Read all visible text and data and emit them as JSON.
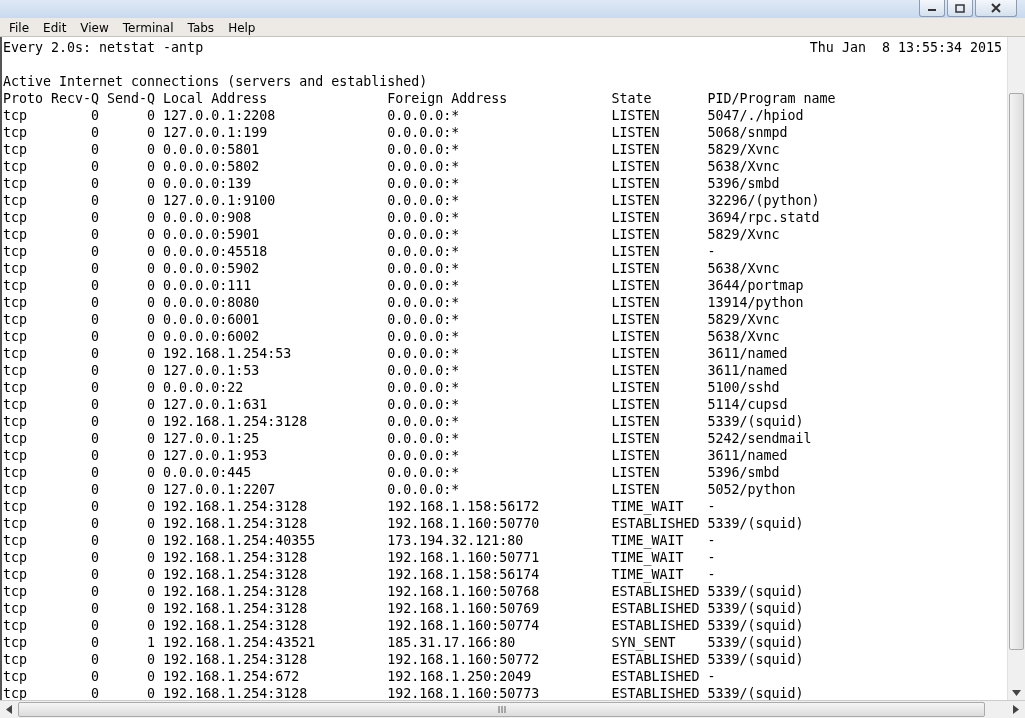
{
  "menu": [
    "File",
    "Edit",
    "View",
    "Terminal",
    "Tabs",
    "Help"
  ],
  "terminal": {
    "command": "Every 2.0s: netstat -antp",
    "clock": "Thu Jan  8 13:55:34 2015",
    "title": "Active Internet connections (servers and established)",
    "columns": [
      "Proto",
      "Recv-Q",
      "Send-Q",
      "Local Address",
      "Foreign Address",
      "State",
      "PID/Program name"
    ],
    "rows": [
      [
        "tcp",
        "0",
        "0",
        "127.0.0.1:2208",
        "0.0.0.0:*",
        "LISTEN",
        "5047/./hpiod"
      ],
      [
        "tcp",
        "0",
        "0",
        "127.0.0.1:199",
        "0.0.0.0:*",
        "LISTEN",
        "5068/snmpd"
      ],
      [
        "tcp",
        "0",
        "0",
        "0.0.0.0:5801",
        "0.0.0.0:*",
        "LISTEN",
        "5829/Xvnc"
      ],
      [
        "tcp",
        "0",
        "0",
        "0.0.0.0:5802",
        "0.0.0.0:*",
        "LISTEN",
        "5638/Xvnc"
      ],
      [
        "tcp",
        "0",
        "0",
        "0.0.0.0:139",
        "0.0.0.0:*",
        "LISTEN",
        "5396/smbd"
      ],
      [
        "tcp",
        "0",
        "0",
        "127.0.0.1:9100",
        "0.0.0.0:*",
        "LISTEN",
        "32296/(python)"
      ],
      [
        "tcp",
        "0",
        "0",
        "0.0.0.0:908",
        "0.0.0.0:*",
        "LISTEN",
        "3694/rpc.statd"
      ],
      [
        "tcp",
        "0",
        "0",
        "0.0.0.0:5901",
        "0.0.0.0:*",
        "LISTEN",
        "5829/Xvnc"
      ],
      [
        "tcp",
        "0",
        "0",
        "0.0.0.0:45518",
        "0.0.0.0:*",
        "LISTEN",
        "-"
      ],
      [
        "tcp",
        "0",
        "0",
        "0.0.0.0:5902",
        "0.0.0.0:*",
        "LISTEN",
        "5638/Xvnc"
      ],
      [
        "tcp",
        "0",
        "0",
        "0.0.0.0:111",
        "0.0.0.0:*",
        "LISTEN",
        "3644/portmap"
      ],
      [
        "tcp",
        "0",
        "0",
        "0.0.0.0:8080",
        "0.0.0.0:*",
        "LISTEN",
        "13914/python"
      ],
      [
        "tcp",
        "0",
        "0",
        "0.0.0.0:6001",
        "0.0.0.0:*",
        "LISTEN",
        "5829/Xvnc"
      ],
      [
        "tcp",
        "0",
        "0",
        "0.0.0.0:6002",
        "0.0.0.0:*",
        "LISTEN",
        "5638/Xvnc"
      ],
      [
        "tcp",
        "0",
        "0",
        "192.168.1.254:53",
        "0.0.0.0:*",
        "LISTEN",
        "3611/named"
      ],
      [
        "tcp",
        "0",
        "0",
        "127.0.0.1:53",
        "0.0.0.0:*",
        "LISTEN",
        "3611/named"
      ],
      [
        "tcp",
        "0",
        "0",
        "0.0.0.0:22",
        "0.0.0.0:*",
        "LISTEN",
        "5100/sshd"
      ],
      [
        "tcp",
        "0",
        "0",
        "127.0.0.1:631",
        "0.0.0.0:*",
        "LISTEN",
        "5114/cupsd"
      ],
      [
        "tcp",
        "0",
        "0",
        "192.168.1.254:3128",
        "0.0.0.0:*",
        "LISTEN",
        "5339/(squid)"
      ],
      [
        "tcp",
        "0",
        "0",
        "127.0.0.1:25",
        "0.0.0.0:*",
        "LISTEN",
        "5242/sendmail"
      ],
      [
        "tcp",
        "0",
        "0",
        "127.0.0.1:953",
        "0.0.0.0:*",
        "LISTEN",
        "3611/named"
      ],
      [
        "tcp",
        "0",
        "0",
        "0.0.0.0:445",
        "0.0.0.0:*",
        "LISTEN",
        "5396/smbd"
      ],
      [
        "tcp",
        "0",
        "0",
        "127.0.0.1:2207",
        "0.0.0.0:*",
        "LISTEN",
        "5052/python"
      ],
      [
        "tcp",
        "0",
        "0",
        "192.168.1.254:3128",
        "192.168.1.158:56172",
        "TIME_WAIT",
        "-"
      ],
      [
        "tcp",
        "0",
        "0",
        "192.168.1.254:3128",
        "192.168.1.160:50770",
        "ESTABLISHED",
        "5339/(squid)"
      ],
      [
        "tcp",
        "0",
        "0",
        "192.168.1.254:40355",
        "173.194.32.121:80",
        "TIME_WAIT",
        "-"
      ],
      [
        "tcp",
        "0",
        "0",
        "192.168.1.254:3128",
        "192.168.1.160:50771",
        "TIME_WAIT",
        "-"
      ],
      [
        "tcp",
        "0",
        "0",
        "192.168.1.254:3128",
        "192.168.1.158:56174",
        "TIME_WAIT",
        "-"
      ],
      [
        "tcp",
        "0",
        "0",
        "192.168.1.254:3128",
        "192.168.1.160:50768",
        "ESTABLISHED",
        "5339/(squid)"
      ],
      [
        "tcp",
        "0",
        "0",
        "192.168.1.254:3128",
        "192.168.1.160:50769",
        "ESTABLISHED",
        "5339/(squid)"
      ],
      [
        "tcp",
        "0",
        "0",
        "192.168.1.254:3128",
        "192.168.1.160:50774",
        "ESTABLISHED",
        "5339/(squid)"
      ],
      [
        "tcp",
        "0",
        "1",
        "192.168.1.254:43521",
        "185.31.17.166:80",
        "SYN_SENT",
        "5339/(squid)"
      ],
      [
        "tcp",
        "0",
        "0",
        "192.168.1.254:3128",
        "192.168.1.160:50772",
        "ESTABLISHED",
        "5339/(squid)"
      ],
      [
        "tcp",
        "0",
        "0",
        "192.168.1.254:672",
        "192.168.1.250:2049",
        "ESTABLISHED",
        "-"
      ],
      [
        "tcp",
        "0",
        "0",
        "192.168.1.254:3128",
        "192.168.1.160:50773",
        "ESTABLISHED",
        "5339/(squid)"
      ]
    ]
  }
}
